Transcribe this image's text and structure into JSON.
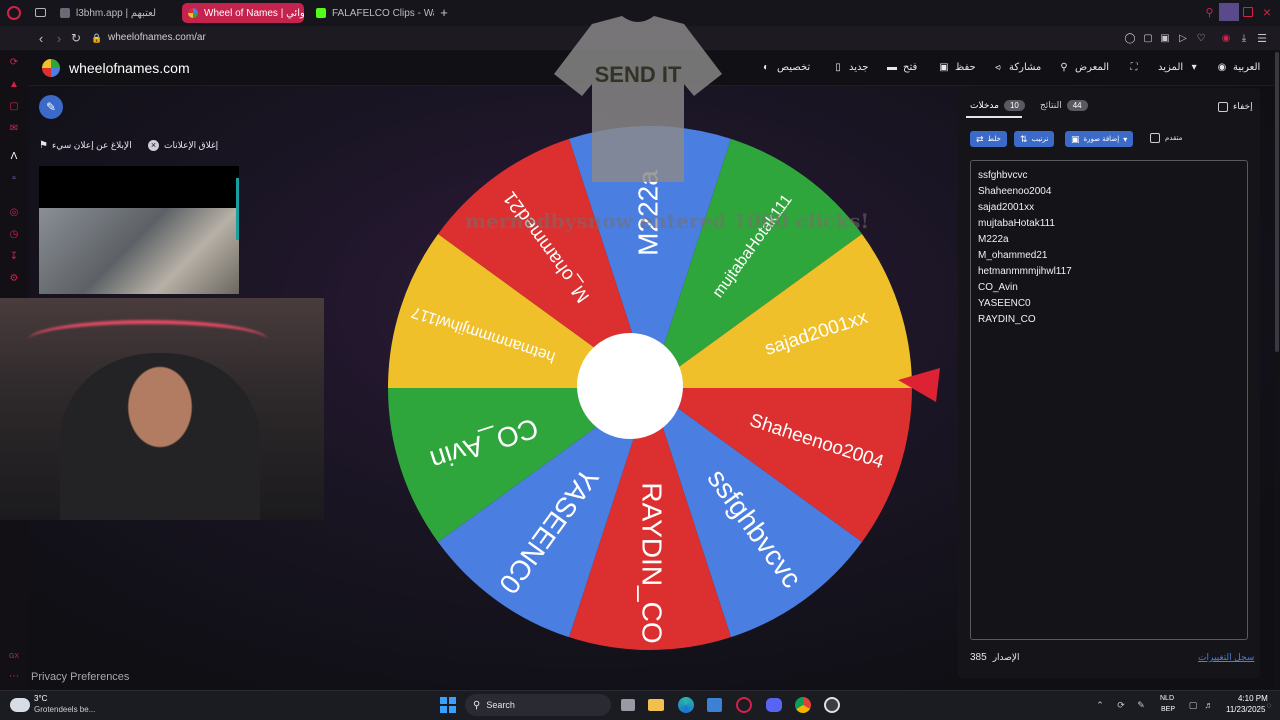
{
  "browser": {
    "tabs": [
      {
        "label": "l3bhm.app | لعتبهم",
        "fav_color": "#6b6b77",
        "active": false
      },
      {
        "label": "Wheel of Names | عشوائي",
        "fav_color": "#e0e0e0",
        "active": true
      },
      {
        "label": "FALAFELCO Clips - Watch",
        "fav_color": "#53fc18",
        "active": false
      }
    ],
    "url": "wheelofnames.com/ar"
  },
  "app": {
    "brand": "wheelofnames.com",
    "nav": {
      "customize": "تخصيص",
      "new": "جديد",
      "open": "فتح",
      "save": "حفظ",
      "share": "مشاركة",
      "gallery": "المعرض",
      "more": "المزيد",
      "language": "العربية"
    }
  },
  "ads": {
    "close_ads": "إغلاق الإعلانات",
    "report_ad": "الإبلاغ عن إعلان سيء"
  },
  "overlay": {
    "shirt_text": "SEND IT",
    "sub_message": "mernedbysnow entered 1000 clicks!"
  },
  "wheel": {
    "segments": [
      {
        "name": "M222a",
        "color": "#4a7ee0"
      },
      {
        "name": "mujtabaHotak111",
        "color": "#2fa63b"
      },
      {
        "name": "sajad2001xx",
        "color": "#f0c02a"
      },
      {
        "name": "Shaheenoo2004",
        "color": "#dc2f2f"
      },
      {
        "name": "ssfghbvcvc",
        "color": "#4a7ee0"
      },
      {
        "name": "RAYDIN_CO",
        "color": "#dc2f2f"
      },
      {
        "name": "YASEENC0",
        "color": "#4a7ee0"
      },
      {
        "name": "CO_Avin",
        "color": "#2fa63b"
      },
      {
        "name": "hetmanmmmjihwl117",
        "color": "#f0c02a"
      },
      {
        "name": "M_ohammed21",
        "color": "#dc2f2f"
      }
    ],
    "pointer_color": "#dd2233"
  },
  "panel": {
    "hide_label": "إخفاء",
    "results_label": "النتائج",
    "results_count": "44",
    "entries_label": "مدخلات",
    "entries_count": "10",
    "shuffle_label": "خلط",
    "sort_label": "ترتيب",
    "add_image_label": "إضافة صورة",
    "advanced_label": "متقدم",
    "entries": [
      "ssfghbvcvc",
      "Shaheenoo2004",
      "sajad2001xx",
      "mujtabaHotak111",
      "M222a",
      "M_ohammed21",
      "hetmanmmmjihwl117",
      "CO_Avin",
      "YASEENC0",
      "RAYDIN_CO"
    ],
    "version_label": "الإصدار",
    "version_number": "385",
    "changelog_label": "سجل التغييرات"
  },
  "footer": {
    "privacy": "Privacy Preferences"
  },
  "taskbar": {
    "weather_temp": "3°C",
    "weather_desc": "Grotendeels be...",
    "search_placeholder": "Search",
    "lang_top": "NLD",
    "lang_bottom": "BEP",
    "time": "4:10 PM",
    "date": "11/23/2025"
  },
  "colors": {
    "accent": "#3b6ac8",
    "tab_active": "#c4234d"
  }
}
